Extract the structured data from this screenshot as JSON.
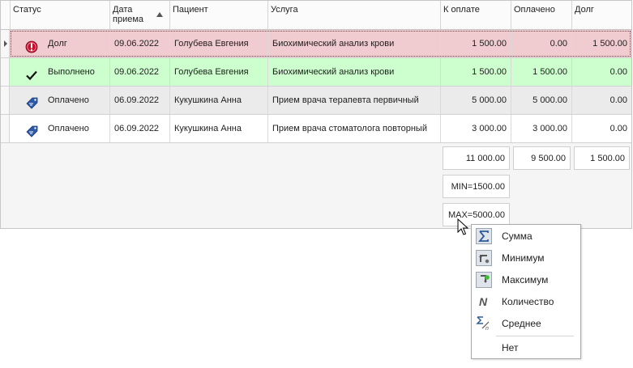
{
  "columns": {
    "status": "Статус",
    "date": "Дата приема",
    "patient": "Пациент",
    "service": "Услуга",
    "to_pay": "К оплате",
    "paid": "Оплачено",
    "debt": "Долг"
  },
  "rows": [
    {
      "status_icon": "exclamation-icon",
      "status": "Долг",
      "date": "09.06.2022",
      "patient": "Голубева Евгения",
      "service": "Биохимический анализ крови",
      "to_pay": "1 500.00",
      "paid": "0.00",
      "debt": "1 500.00",
      "bg": "#f0ccd0"
    },
    {
      "status_icon": "checkmark-icon",
      "status": "Выполнено",
      "date": "09.06.2022",
      "patient": "Голубева Евгения",
      "service": "Биохимический анализ крови",
      "to_pay": "1 500.00",
      "paid": "1 500.00",
      "debt": "0.00",
      "bg": "#cdfecd"
    },
    {
      "status_icon": "price-tag-icon",
      "status": "Оплачено",
      "date": "06.09.2022",
      "patient": "Кукушкина Анна",
      "service": "Прием врача терапевта первичный",
      "to_pay": "5 000.00",
      "paid": "5 000.00",
      "debt": "0.00",
      "bg": "#ebebeb"
    },
    {
      "status_icon": "price-tag-icon",
      "status": "Оплачено",
      "date": "06.09.2022",
      "patient": "Кукушкина Анна",
      "service": "Прием врача стоматолога повторный",
      "to_pay": "3 000.00",
      "paid": "3 000.00",
      "debt": "0.00",
      "bg": "#ffffff"
    }
  ],
  "footer": {
    "to_pay_sum": "11 000.00",
    "paid_sum": "9 500.00",
    "debt_sum": "1 500.00",
    "to_pay_min": "MIN=1500.00",
    "to_pay_max": "MAX=5000.00"
  },
  "summary_menu": {
    "items": [
      {
        "icon": "sigma-icon",
        "label": "Сумма",
        "selected": true
      },
      {
        "icon": "minimum-icon",
        "label": "Минимум",
        "selected": true
      },
      {
        "icon": "maximum-icon",
        "label": "Максимум",
        "selected": true
      },
      {
        "icon": "count-icon",
        "label": "Количество",
        "selected": false
      },
      {
        "icon": "average-icon",
        "label": "Среднее",
        "selected": false
      },
      {
        "icon": "",
        "label": "Нет",
        "selected": false
      }
    ]
  },
  "colors": {
    "debt_row": "#f0ccd0",
    "done_row": "#cdfecd",
    "paid_row_alt": "#ebebeb",
    "grid_border": "#c6c6c6"
  }
}
